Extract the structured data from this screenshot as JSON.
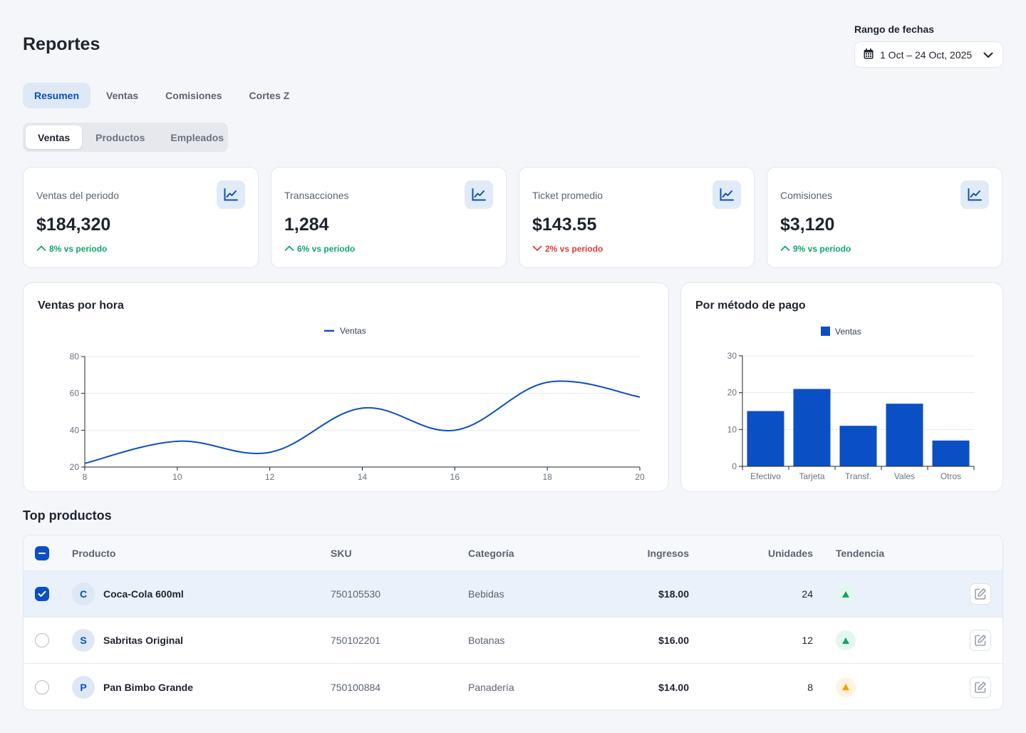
{
  "page": {
    "title": "Reportes"
  },
  "date_range": {
    "label": "Rango de fechas",
    "value": "1 Oct – 24 Oct, 2025"
  },
  "tabs": [
    {
      "label": "Resumen",
      "active": true
    },
    {
      "label": "Ventas",
      "active": false
    },
    {
      "label": "Comisiones",
      "active": false
    },
    {
      "label": "Cortes Z",
      "active": false
    }
  ],
  "subtabs": [
    {
      "label": "Ventas",
      "active": true
    },
    {
      "label": "Productos",
      "active": false
    },
    {
      "label": "Empleados",
      "active": false
    }
  ],
  "kpis": [
    {
      "label": "Ventas del periodo",
      "value": "$184,320",
      "delta": "8% vs periodo",
      "direction": "up"
    },
    {
      "label": "Transacciones",
      "value": "1,284",
      "delta": "6% vs periodo",
      "direction": "up"
    },
    {
      "label": "Ticket promedio",
      "value": "$143.55",
      "delta": "2% vs periodo",
      "direction": "down"
    },
    {
      "label": "Comisiones",
      "value": "$3,120",
      "delta": "9% vs periodo",
      "direction": "up"
    }
  ],
  "chart_data": [
    {
      "type": "line",
      "title": "Ventas por hora",
      "x": [
        8,
        10,
        12,
        14,
        16,
        18,
        20
      ],
      "series": [
        {
          "name": "Ventas",
          "values": [
            22,
            34,
            28,
            52,
            40,
            66,
            58
          ]
        }
      ],
      "xlim": [
        8,
        20
      ],
      "ylim": [
        20,
        80
      ],
      "xticks": [
        "8",
        "10",
        "12",
        "14",
        "16",
        "18",
        "20"
      ],
      "yticks": [
        "20",
        "40",
        "60",
        "80"
      ],
      "grid": true,
      "legend_position": "top-center",
      "color": "#0b4fc4"
    },
    {
      "type": "bar",
      "title": "Por método de pago",
      "categories": [
        "Efectivo",
        "Tarjeta",
        "Transf.",
        "Vales",
        "Otros"
      ],
      "series": [
        {
          "name": "Ventas",
          "values": [
            15,
            21,
            11,
            17,
            7
          ]
        }
      ],
      "ylim": [
        0,
        30
      ],
      "yticks": [
        "0",
        "10",
        "20",
        "30"
      ],
      "grid": true,
      "legend_position": "top-center",
      "color": "#0b4fc4"
    }
  ],
  "top_products": {
    "title": "Top productos",
    "columns": [
      "Producto",
      "SKU",
      "Categoría",
      "Ingresos",
      "Unidades",
      "Tendencia"
    ],
    "rows": [
      {
        "initial": "C",
        "name": "Coca-Cola 600ml",
        "sku": "750105530",
        "category": "Bebidas",
        "revenue": "$18.00",
        "units": "24",
        "trend": "up",
        "selected": true
      },
      {
        "initial": "S",
        "name": "Sabritas Original",
        "sku": "750102201",
        "category": "Botanas",
        "revenue": "$16.00",
        "units": "12",
        "trend": "up",
        "selected": false
      },
      {
        "initial": "P",
        "name": "Pan Bimbo Grande",
        "sku": "750100884",
        "category": "Panadería",
        "revenue": "$14.00",
        "units": "8",
        "trend": "warn",
        "selected": false
      }
    ]
  },
  "colors": {
    "accent": "#0b4fc4",
    "up": "#12a56b",
    "down": "#e03a3a",
    "warn": "#f59e0b"
  }
}
